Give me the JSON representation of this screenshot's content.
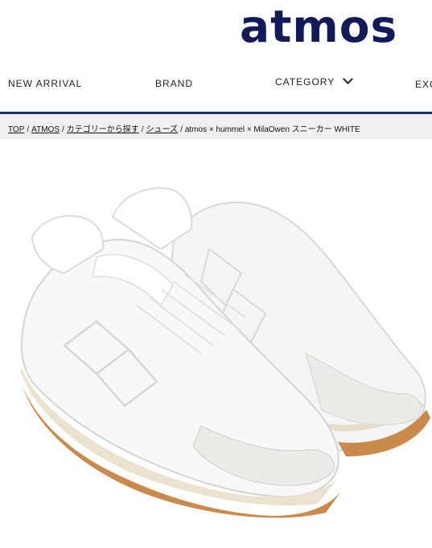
{
  "brand": {
    "logo_text": "atmos",
    "color": "#121b57"
  },
  "nav": {
    "items": [
      {
        "label": "NEW ARRIVAL"
      },
      {
        "label": "BRAND"
      },
      {
        "label": "CATEGORY"
      },
      {
        "label": "EXC"
      }
    ]
  },
  "breadcrumb": {
    "links": [
      {
        "label": "TOP"
      },
      {
        "label": "ATMOS"
      },
      {
        "label": "カテゴリーから探す"
      },
      {
        "label": "シューズ"
      }
    ],
    "separator": "/",
    "current": "atmos × hummel × MilaOwen スニーカー WHITE"
  },
  "product": {
    "image_icon": "white-sneaker-image",
    "shoe_color": "#f4f4f4",
    "sole_color": "#c98a4b",
    "accent_color": "#1d2d6b"
  }
}
